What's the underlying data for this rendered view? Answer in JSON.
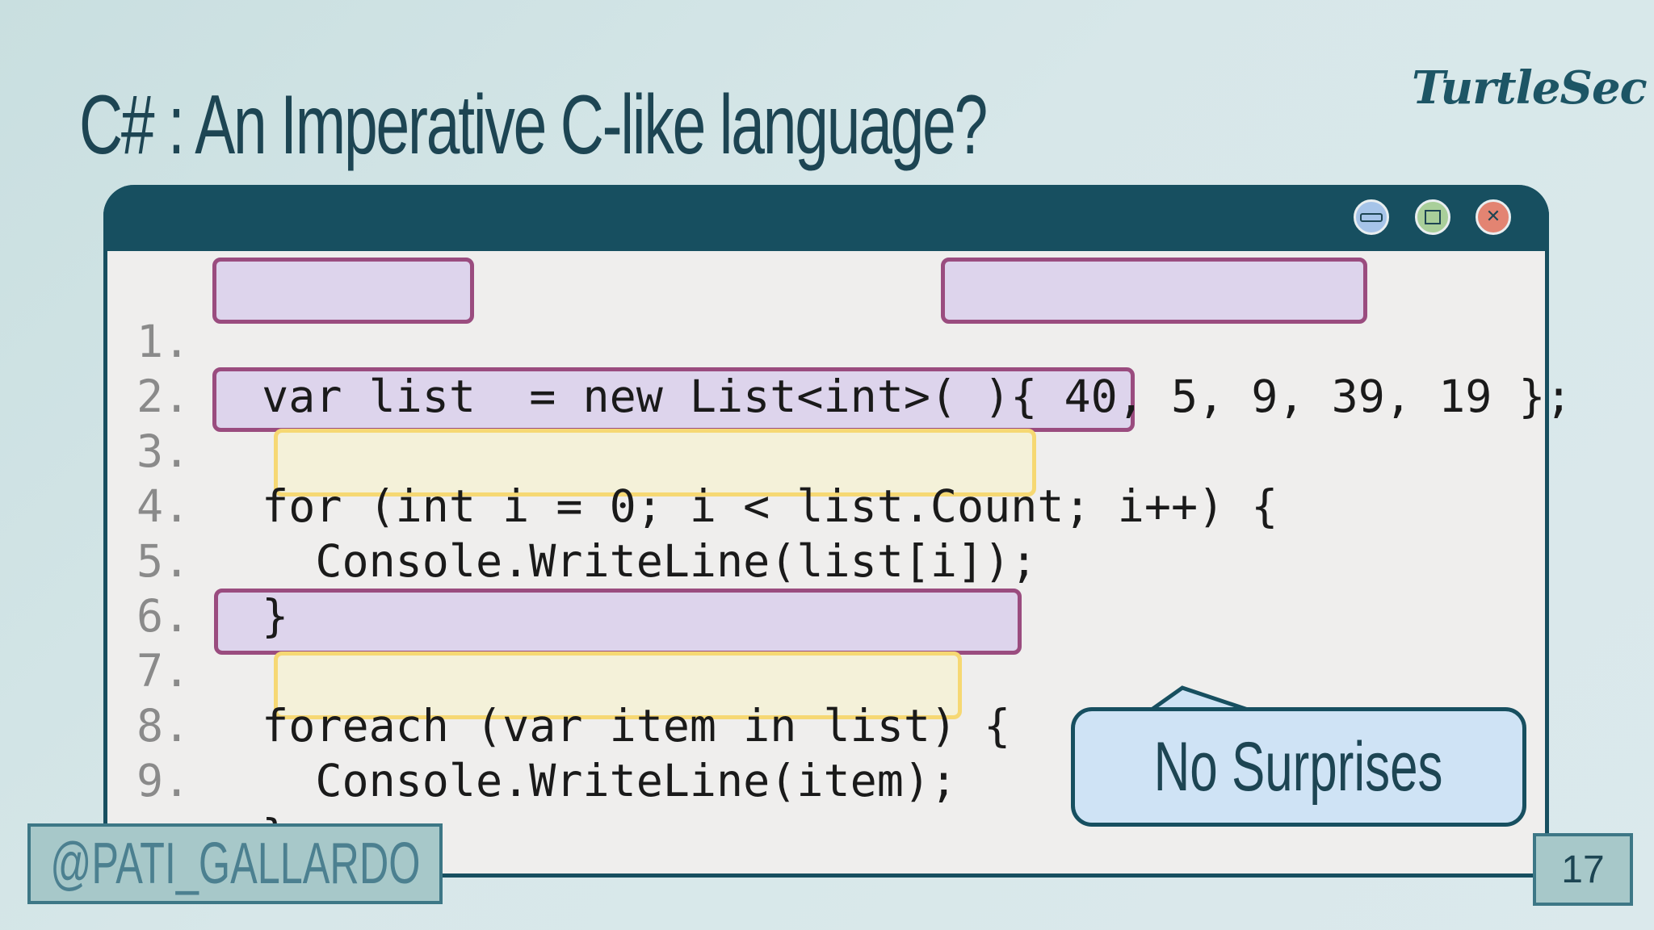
{
  "slide": {
    "title": "C# : An Imperative C-like language?",
    "brand": "TurtleSec",
    "handle": "@PATI_GALLARDO",
    "page_number": "17",
    "callout": "No Surprises"
  },
  "window_controls": {
    "minimize_icon": "minimize-icon",
    "maximize_icon": "maximize-icon",
    "close_icon": "close-icon",
    "close_glyph": "✕"
  },
  "code": {
    "lines": [
      {
        "num": "1.",
        "text": " var list  = new List<int>( ){ 40, 5, 9, 39, 19 };"
      },
      {
        "num": "2.",
        "text": ""
      },
      {
        "num": "3.",
        "text": " for (int i = 0; i < list.Count; i++) {"
      },
      {
        "num": "4.",
        "text": "   Console.WriteLine(list[i]);"
      },
      {
        "num": "5.",
        "text": " }"
      },
      {
        "num": "6.",
        "text": ""
      },
      {
        "num": "7.",
        "text": " foreach (var item in list) {"
      },
      {
        "num": "8.",
        "text": "   Console.WriteLine(item);"
      },
      {
        "num": "9.",
        "text": " }"
      }
    ]
  },
  "colors": {
    "purple_highlight": "#ddd4ec",
    "purple_border": "#9a4c7f",
    "yellow_highlight": "#f4f1d9",
    "yellow_border": "#f6d873",
    "window_frame": "#174f60"
  }
}
